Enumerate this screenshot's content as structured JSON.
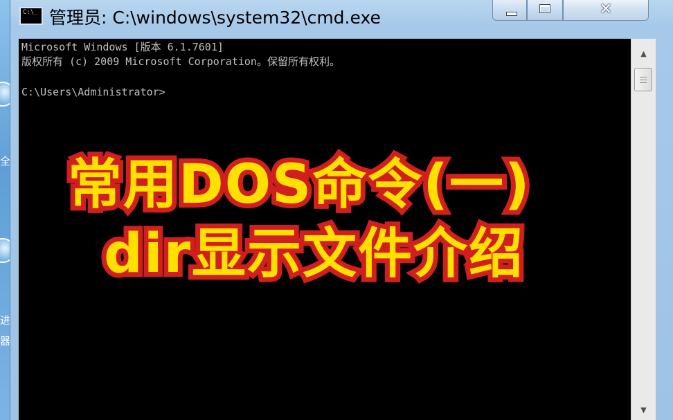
{
  "window": {
    "title": "管理员: C:\\windows\\system32\\cmd.exe",
    "app_icon_label": "C:\\_"
  },
  "controls": {
    "minimize_icon": "minimize-icon",
    "maximize_icon": "maximize-icon",
    "close_glyph": "✕"
  },
  "console": {
    "lines": [
      "Microsoft Windows [版本 6.1.7601]",
      "版权所有 (c) 2009 Microsoft Corporation。保留所有权利。",
      "",
      "C:\\Users\\Administrator>"
    ]
  },
  "scrollbar": {
    "up_glyph": "▲",
    "down_glyph": "▼"
  },
  "overlay": {
    "line1": "常用DOS命令(一)",
    "line2": "dir显示文件介绍"
  },
  "desktop": {
    "glyph1": "全",
    "glyph2": "进",
    "glyph3": "器"
  },
  "colors": {
    "overlay_fill": "#ffe000",
    "overlay_stroke": "#d11f1f",
    "console_text": "#c0c0c0",
    "console_bg": "#000000"
  }
}
